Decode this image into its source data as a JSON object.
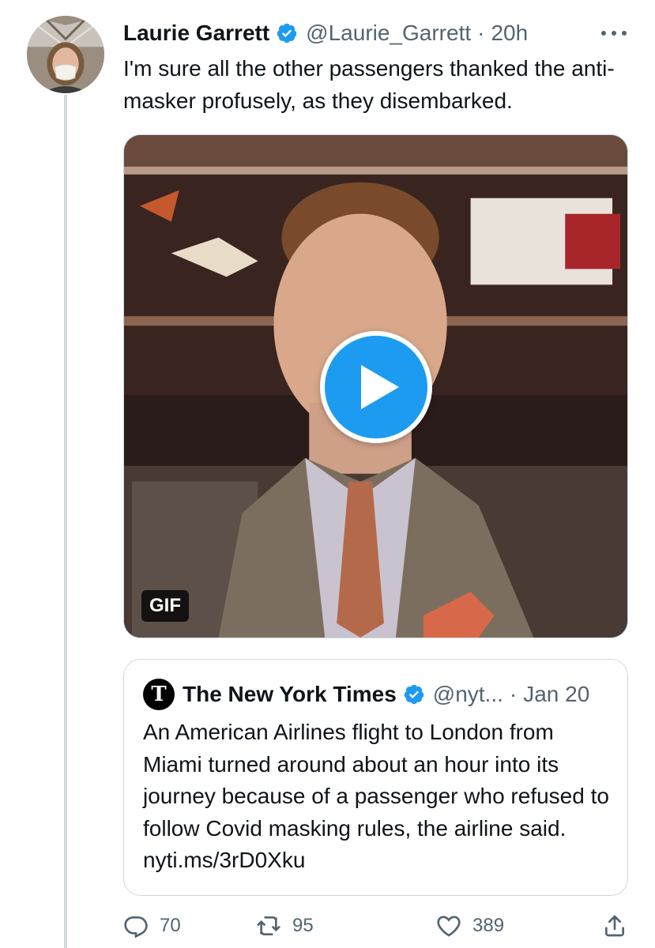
{
  "tweet": {
    "author": {
      "display_name": "Laurie Garrett",
      "handle": "@Laurie_Garrett",
      "verified": true,
      "avatar": "profile photo of a person wearing a face mask"
    },
    "separator": "·",
    "time": "20h",
    "text": "I'm sure all the other passengers thanked the anti-masker profusely, as they disembarked.",
    "media": {
      "type": "GIF",
      "badge": "GIF",
      "play_icon": "play-icon"
    },
    "quoted_tweet": {
      "logo_glyph": "T",
      "display_name": "The New York Times",
      "verified": true,
      "handle": "@nyt...",
      "separator": "·",
      "date": "Jan 20",
      "text": "An American Airlines flight to London from Miami turned around about an hour into its journey because of a passenger who refused to follow Covid masking rules, the airline said. nyti.ms/3rD0Xku"
    },
    "actions": {
      "replies": "70",
      "retweets": "95",
      "likes": "389"
    }
  },
  "colors": {
    "verified_blue": "#1d9bf0",
    "secondary_text": "#536471",
    "primary_text": "#0f1419",
    "border": "#cfd9de"
  }
}
